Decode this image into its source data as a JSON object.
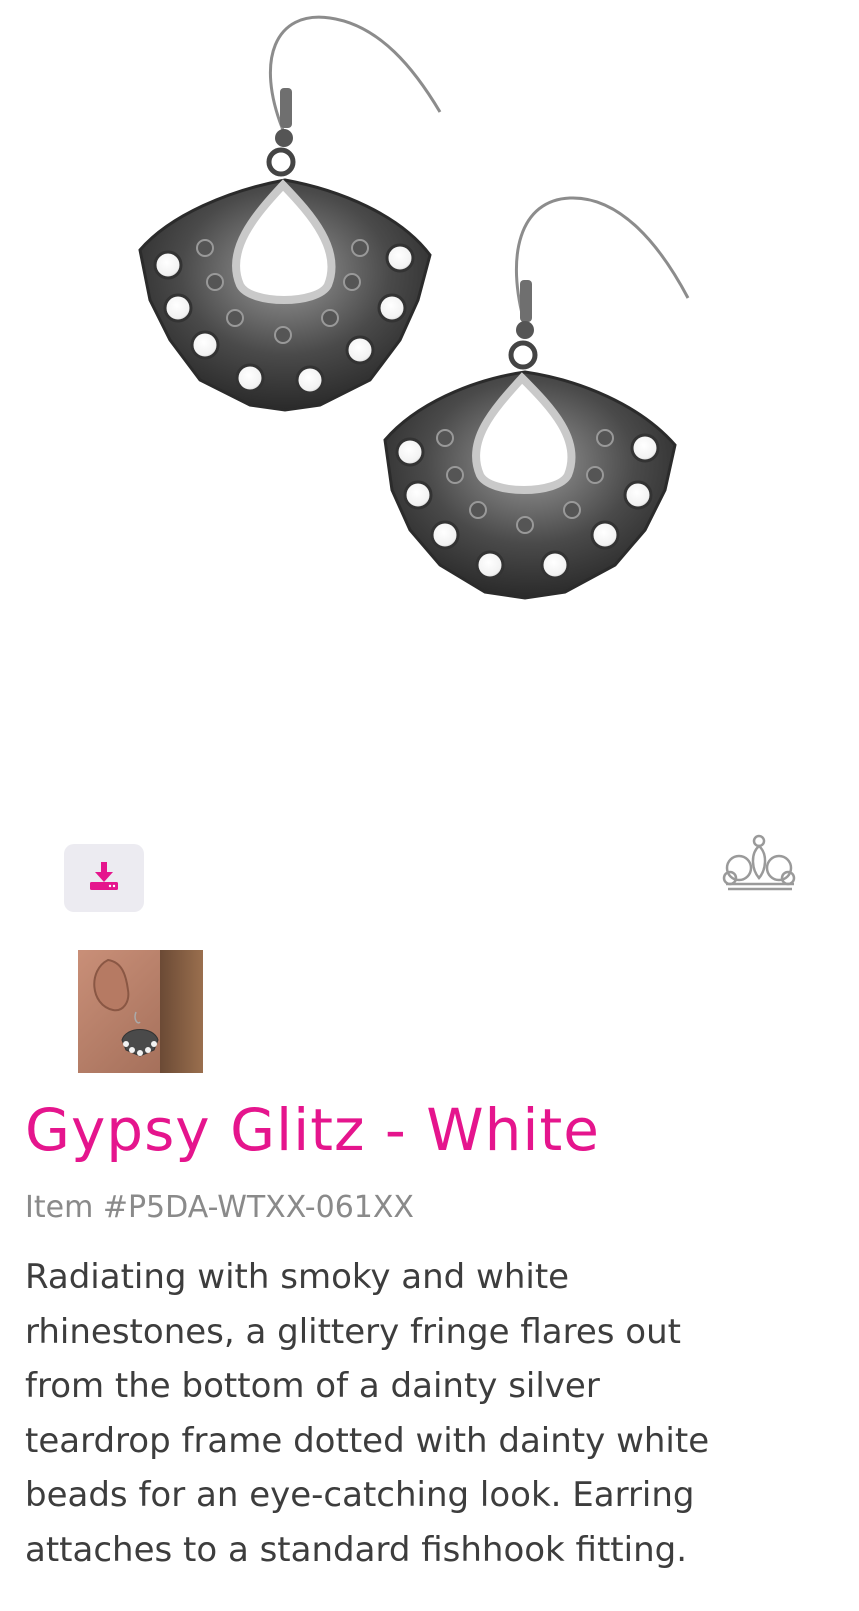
{
  "product": {
    "title": "Gypsy Glitz - White",
    "item_number": "Item #P5DA-WTXX-061XX",
    "description_lines": [
      "Radiating with smoky and white",
      "rhinestones, a glittery fringe flares out",
      "from the bottom of a dainty silver",
      "teardrop frame dotted with dainty white",
      "beads for an eye-catching look. Earring",
      "attaches to a standard fishhook fitting."
    ]
  },
  "icons": {
    "download": "download-icon",
    "crown": "crown-logo-icon"
  },
  "colors": {
    "accent": "#e5158d",
    "item_text": "#8a8a8a",
    "body_text": "#3d3d3d",
    "download_button_bg": "#ecebf1",
    "crown_outline": "#9a9a9a"
  }
}
